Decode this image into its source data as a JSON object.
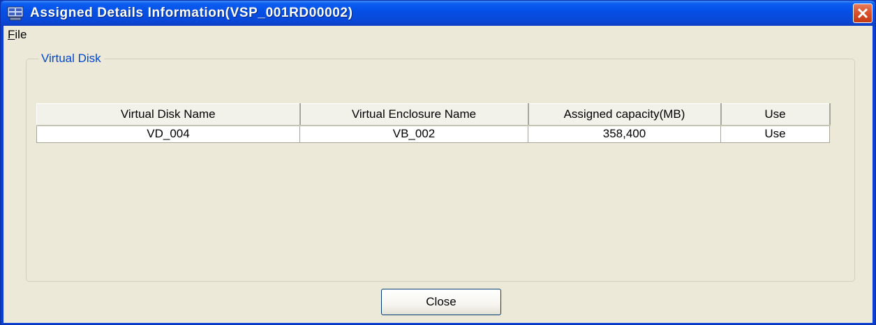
{
  "window": {
    "title": "Assigned Details Information(VSP_001RD00002)",
    "title_icon": "storage-app-icon",
    "close_icon": "close-icon"
  },
  "menubar": {
    "file_underline": "F",
    "file_rest": "ile"
  },
  "group": {
    "label": "Virtual Disk"
  },
  "table": {
    "columns": [
      "Virtual Disk Name",
      "Virtual Enclosure Name",
      "Assigned capacity(MB)",
      "Use"
    ],
    "rows": [
      [
        "VD_004",
        "VB_002",
        "358,400",
        "Use"
      ]
    ]
  },
  "footer": {
    "close_label": "Close"
  },
  "colors": {
    "titlebar": "#0a48d8",
    "client": "#ece9d8",
    "group_label": "#0046d5",
    "close_button": "#d9502a"
  }
}
